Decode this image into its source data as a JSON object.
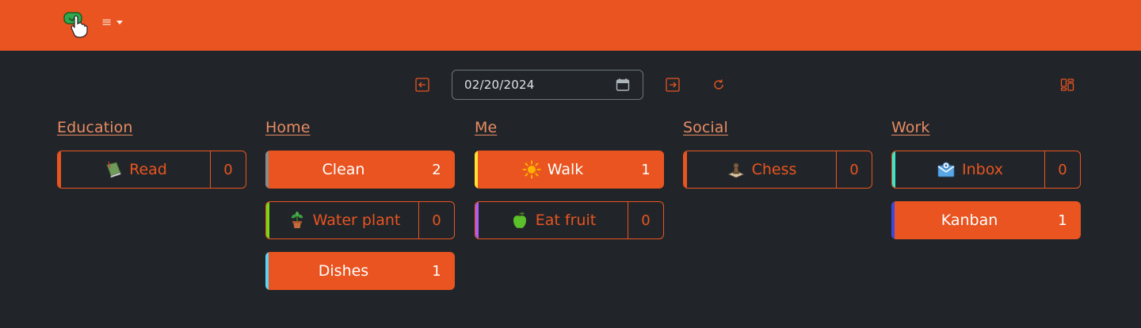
{
  "navbar": {
    "menu_glyph": "≡"
  },
  "toolbar": {
    "date_value": "02/20/2024",
    "icons": [
      "prev-day-icon",
      "calendar-icon",
      "next-day-icon",
      "refresh-icon",
      "layout-icon"
    ]
  },
  "colors": {
    "accent": "#e95420",
    "bg": "#212529",
    "title": "#e88b63"
  },
  "columns": [
    {
      "title": "Education",
      "habits": [
        {
          "label": "Read",
          "count": "0",
          "icon": "book-icon",
          "style": "outline",
          "accent": "#e95420"
        }
      ]
    },
    {
      "title": "Home",
      "habits": [
        {
          "label": "Clean",
          "count": "2",
          "icon": "",
          "style": "filled",
          "accent": "#8a8a8a"
        },
        {
          "label": "Water plant",
          "count": "0",
          "icon": "potted-plant-icon",
          "style": "outline",
          "accent": "#7bd615"
        },
        {
          "label": "Dishes",
          "count": "1",
          "icon": "",
          "style": "filled",
          "accent": "#5fd3f3"
        }
      ]
    },
    {
      "title": "Me",
      "habits": [
        {
          "label": "Walk",
          "count": "1",
          "icon": "sun-icon",
          "style": "filled",
          "accent": "#ffe135"
        },
        {
          "label": "Eat fruit",
          "count": "0",
          "icon": "green-apple-icon",
          "style": "outline",
          "accent": "#b05cf0"
        }
      ]
    },
    {
      "title": "Social",
      "habits": [
        {
          "label": "Chess",
          "count": "0",
          "icon": "chess-icon",
          "style": "outline",
          "accent": "#e95420"
        }
      ]
    },
    {
      "title": "Work",
      "habits": [
        {
          "label": "Inbox",
          "count": "0",
          "icon": "envelope-icon",
          "style": "outline",
          "accent": "#3ee6c4"
        },
        {
          "label": "Kanban",
          "count": "1",
          "icon": "",
          "style": "filled",
          "accent": "#3b48e0"
        }
      ]
    }
  ]
}
